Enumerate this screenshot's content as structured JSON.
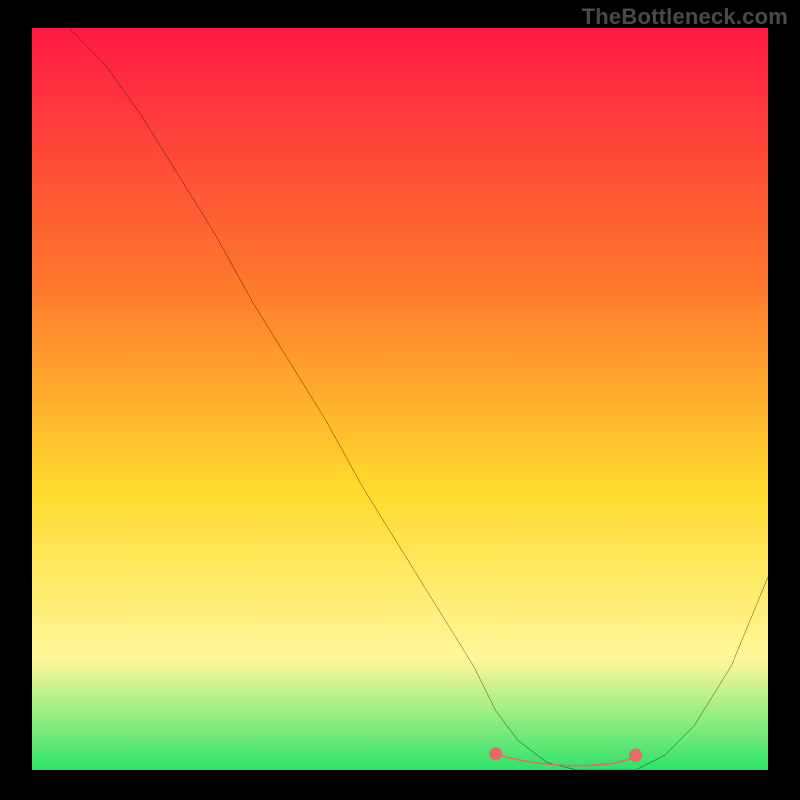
{
  "watermark": "TheBottleneck.com",
  "colors": {
    "background": "#000000",
    "gradient_top": "#ff1a44",
    "gradient_mid1": "#ff7a2b",
    "gradient_mid2": "#ffd92b",
    "gradient_mid3": "#fff89a",
    "gradient_bottom": "#2fe36a",
    "curve": "#000000",
    "marker": "#e96a6a"
  },
  "chart_data": {
    "type": "line",
    "title": "",
    "xlabel": "",
    "ylabel": "",
    "x": [
      0,
      5,
      10,
      15,
      20,
      25,
      30,
      35,
      40,
      45,
      50,
      55,
      60,
      63,
      66,
      70,
      74,
      78,
      80,
      82,
      86,
      90,
      95,
      100
    ],
    "values": [
      103,
      100,
      95,
      88,
      80,
      72,
      63,
      55,
      47,
      38,
      30,
      22,
      14,
      8,
      4,
      1,
      0,
      0,
      0,
      0,
      2,
      6,
      14,
      26
    ],
    "xlim": [
      0,
      100
    ],
    "ylim": [
      0,
      100
    ],
    "valley_marker": {
      "x_start": 63,
      "x_end": 82,
      "points_x": [
        63,
        65,
        67,
        69,
        71,
        73,
        75,
        77,
        79,
        81,
        82
      ],
      "points_y": [
        2.2,
        1.6,
        1.2,
        0.9,
        0.7,
        0.6,
        0.6,
        0.7,
        0.9,
        1.4,
        2.0
      ]
    }
  }
}
